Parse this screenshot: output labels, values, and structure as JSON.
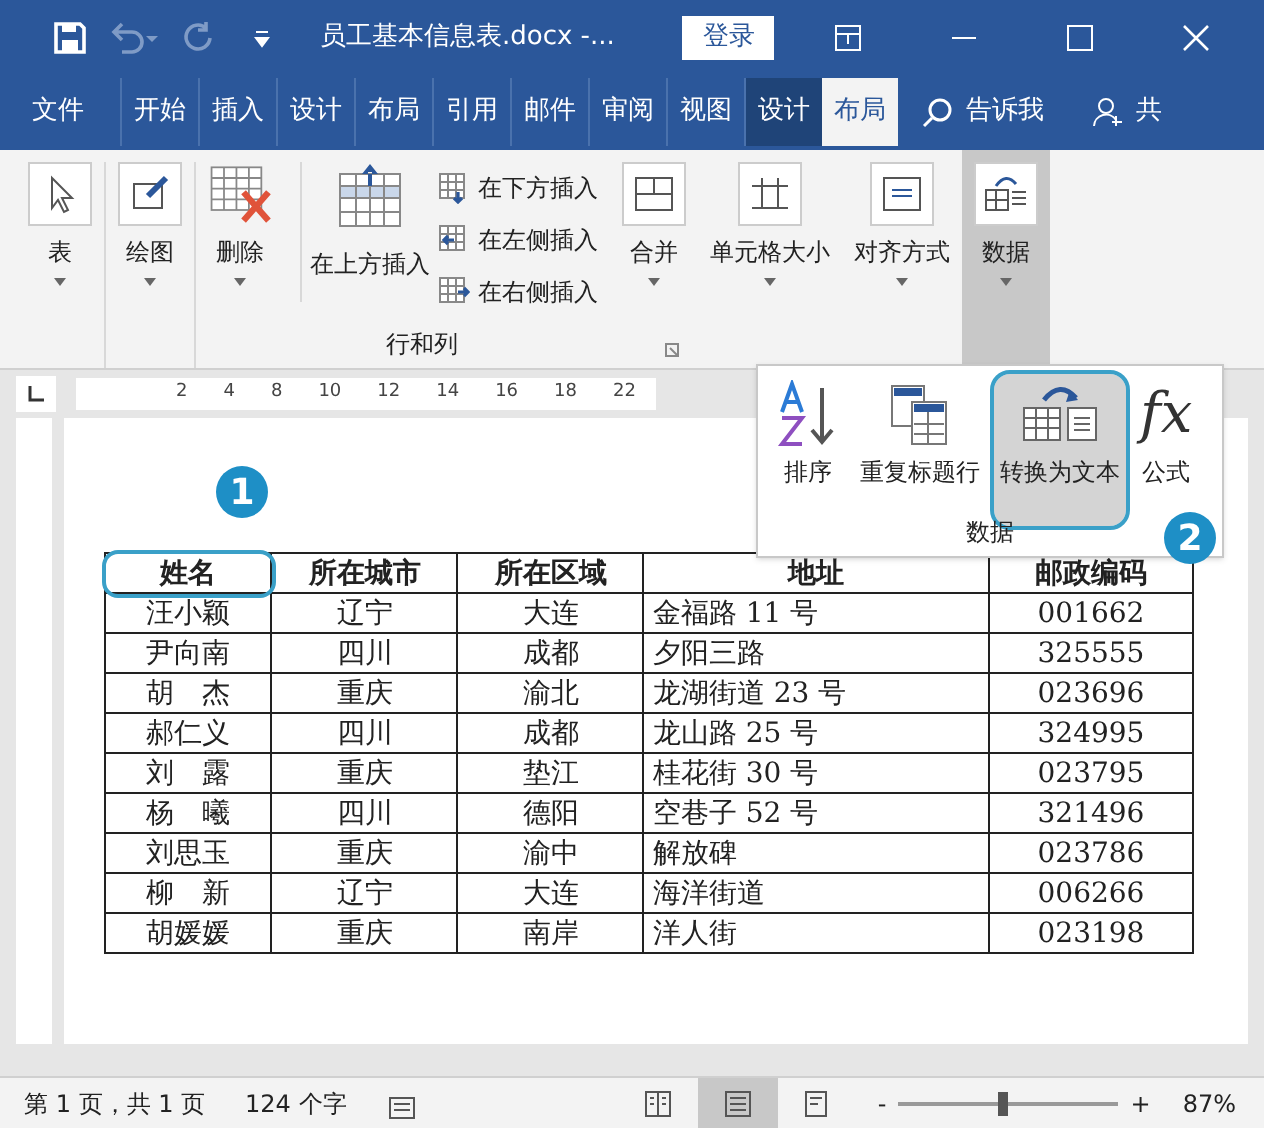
{
  "title_bar": {
    "title": "员工基本信息表.docx -...",
    "login": "登录"
  },
  "menu_tabs": [
    {
      "label": "文件",
      "selected": false
    },
    {
      "label": "开始",
      "selected": false
    },
    {
      "label": "插入",
      "selected": false
    },
    {
      "label": "设计",
      "selected": false
    },
    {
      "label": "布局",
      "selected": false
    },
    {
      "label": "引用",
      "selected": false
    },
    {
      "label": "邮件",
      "selected": false
    },
    {
      "label": "审阅",
      "selected": false
    },
    {
      "label": "视图",
      "selected": false
    },
    {
      "label": "设计",
      "selected": false
    },
    {
      "label": "布局",
      "selected": true
    }
  ],
  "tell_me": "告诉我",
  "share": "共",
  "ribbon": {
    "tools": [
      {
        "kind": "big",
        "label": "表",
        "selected": false
      },
      {
        "kind": "big",
        "label": "绘图",
        "selected": false
      },
      {
        "kind": "big",
        "label": "删除",
        "selected": false
      },
      {
        "kind": "insert",
        "label": "在上方插入",
        "selected": false
      },
      {
        "kind": "small-stack",
        "items": [
          {
            "label": "在下方插入"
          },
          {
            "label": "在左侧插入"
          },
          {
            "label": "在右侧插入"
          }
        ]
      },
      {
        "kind": "big",
        "label": "合并",
        "selected": false
      },
      {
        "kind": "big",
        "label": "单元格大小",
        "selected": false
      },
      {
        "kind": "big",
        "label": "对齐方式",
        "selected": false
      },
      {
        "kind": "big",
        "label": "数据",
        "selected": true
      }
    ],
    "group_label": "行和列"
  },
  "ruler_numbers": [
    "2",
    "4",
    "8",
    "10",
    "12",
    "14",
    "16",
    "18",
    "22"
  ],
  "data_popup": {
    "items": [
      {
        "label": "排序",
        "selected": false
      },
      {
        "label": "重复标题行",
        "selected": false
      },
      {
        "label": "转换为文本",
        "selected": true
      },
      {
        "label": "公式",
        "selected": false
      }
    ],
    "fx": "fx",
    "group_label": "数据"
  },
  "callouts": [
    "1",
    "2"
  ],
  "table": {
    "columns": [
      "姓名",
      "所在城市",
      "所在区域",
      "地址",
      "邮政编码"
    ],
    "rows": [
      [
        "汪小颖",
        "辽宁",
        "大连",
        "金福路 11 号",
        "001662"
      ],
      [
        "尹向南",
        "四川",
        "成都",
        "夕阳三路",
        "325555"
      ],
      [
        "胡　杰",
        "重庆",
        "渝北",
        "龙湖街道 23 号",
        "023696"
      ],
      [
        "郝仁义",
        "四川",
        "成都",
        "龙山路 25 号",
        "324995"
      ],
      [
        "刘　露",
        "重庆",
        "垫江",
        "桂花街 30 号",
        "023795"
      ],
      [
        "杨　曦",
        "四川",
        "德阳",
        "空巷子 52 号",
        "321496"
      ],
      [
        "刘思玉",
        "重庆",
        "渝中",
        "解放碑",
        "023786"
      ],
      [
        "柳　新",
        "辽宁",
        "大连",
        "海洋街道",
        "006266"
      ],
      [
        "胡媛媛",
        "重庆",
        "南岸",
        "洋人街",
        "023198"
      ]
    ]
  },
  "status_bar": {
    "page": "第 1 页，共 1 页",
    "words": "124 个字",
    "views": [
      {
        "selected": false
      },
      {
        "selected": true
      },
      {
        "selected": false
      }
    ],
    "zoom_minus": "-",
    "zoom_plus": "+",
    "zoom": {
      "level": 0.47
    },
    "zoom_text": "87%"
  }
}
